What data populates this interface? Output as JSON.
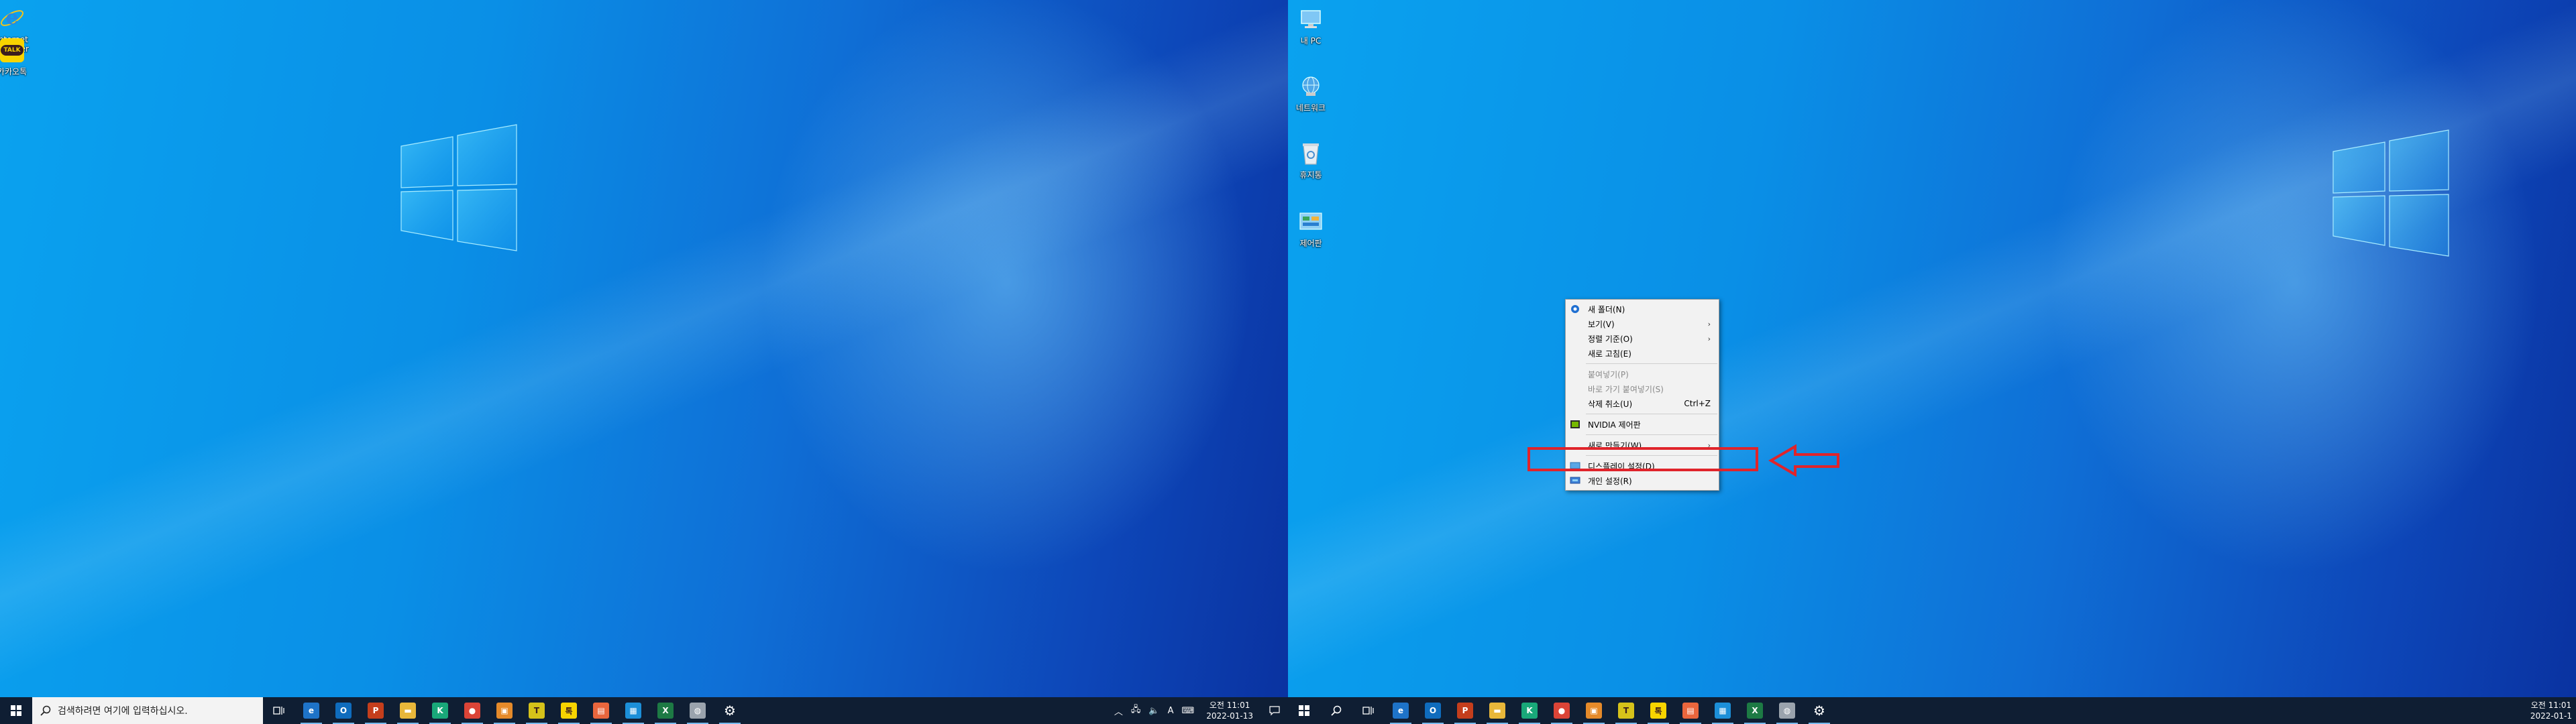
{
  "left_desktop": {
    "icons": [
      {
        "label": "Internet Explorer",
        "icon": "internet-explorer-icon"
      },
      {
        "label": "카카오톡",
        "icon": "kakaotalk-icon",
        "badge": "TALK"
      }
    ]
  },
  "right_desktop": {
    "icons": [
      {
        "label": "내 PC",
        "icon": "this-pc-icon"
      },
      {
        "label": "네트워크",
        "icon": "network-icon"
      },
      {
        "label": "휴지통",
        "icon": "recycle-bin-icon"
      },
      {
        "label": "제어판",
        "icon": "control-panel-icon"
      }
    ]
  },
  "taskbar": {
    "search_placeholder": "검색하려면 여기에 입력하십시오.",
    "apps": [
      {
        "name": "edge",
        "icon": "edge-icon",
        "glyph": "e",
        "color": "#1e73c8"
      },
      {
        "name": "outlook",
        "icon": "mail-app-icon",
        "glyph": "O",
        "color": "#0f6cbd"
      },
      {
        "name": "powerpoint",
        "icon": "powerpoint-icon",
        "glyph": "P",
        "color": "#c43e1c"
      },
      {
        "name": "file-explorer",
        "icon": "file-explorer-icon",
        "glyph": "▬",
        "color": "#e8b73a"
      },
      {
        "name": "k-app",
        "icon": "k-app-icon",
        "glyph": "K",
        "color": "#19a879"
      },
      {
        "name": "chrome",
        "icon": "chrome-icon",
        "glyph": "●",
        "color": "#db4437"
      },
      {
        "name": "photo-app",
        "icon": "photo-app-icon",
        "glyph": "▣",
        "color": "#e58a2a"
      },
      {
        "name": "t-app",
        "icon": "t-app-icon",
        "glyph": "T",
        "color": "#d6c21a"
      },
      {
        "name": "kakaotalk",
        "icon": "kakaotalk-taskbar-icon",
        "glyph": "톡",
        "color": "#f7d400"
      },
      {
        "name": "paint-app",
        "icon": "paint-app-icon",
        "glyph": "▤",
        "color": "#e9663d"
      },
      {
        "name": "notepad-app",
        "icon": "notepad-app-icon",
        "glyph": "▦",
        "color": "#1c8fd8"
      },
      {
        "name": "excel",
        "icon": "excel-icon",
        "glyph": "X",
        "color": "#1d7a44"
      },
      {
        "name": "network-app",
        "icon": "network-app-icon",
        "glyph": "◍",
        "color": "#9aa3ad"
      },
      {
        "name": "settings",
        "icon": "settings-gear-icon",
        "glyph": "⚙",
        "color": "#0f1e33"
      }
    ],
    "tray_ime": "A",
    "clock_time": "오전 11:01",
    "clock_date": "2022-01-13",
    "right_clock_date": "2022-01-1"
  },
  "context_menu": {
    "items": [
      {
        "type": "item",
        "label": "새 폴더(N)",
        "icon": "new-folder-icon"
      },
      {
        "type": "item",
        "label": "보기(V)",
        "submenu": true
      },
      {
        "type": "item",
        "label": "정렬 기준(O)",
        "submenu": true
      },
      {
        "type": "item",
        "label": "새로 고침(E)"
      },
      {
        "type": "sep"
      },
      {
        "type": "item",
        "label": "붙여넣기(P)",
        "disabled": true
      },
      {
        "type": "item",
        "label": "바로 가기 붙여넣기(S)",
        "disabled": true
      },
      {
        "type": "item",
        "label": "삭제 취소(U)",
        "shortcut": "Ctrl+Z"
      },
      {
        "type": "sep"
      },
      {
        "type": "item",
        "label": "NVIDIA 제어판",
        "icon": "nvidia-icon"
      },
      {
        "type": "sep"
      },
      {
        "type": "item",
        "label": "새로 만들기(W)",
        "submenu": true
      },
      {
        "type": "sep"
      },
      {
        "type": "item",
        "label": "디스플레이 설정(D)",
        "icon": "display-settings-icon",
        "highlighted": true
      },
      {
        "type": "item",
        "label": "개인 설정(R)",
        "icon": "personalize-icon"
      }
    ]
  },
  "colors": {
    "taskbar": "#0f1e33",
    "highlight": "#e0242b",
    "wallpaper_light": "#0aa2ef",
    "wallpaper_dark": "#0a32a0"
  }
}
